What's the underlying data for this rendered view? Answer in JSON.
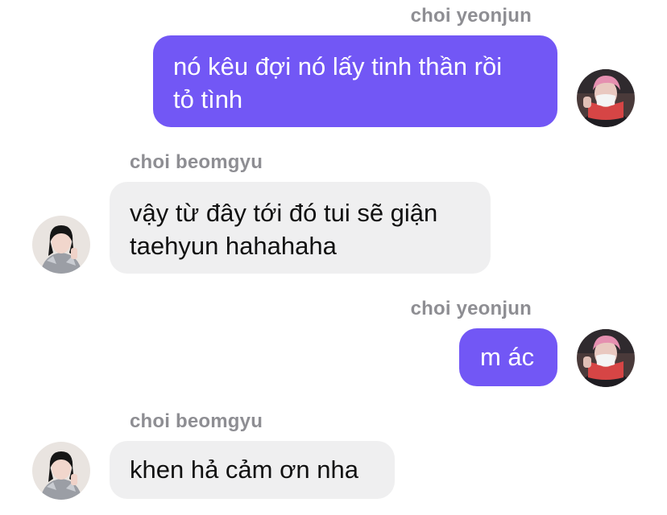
{
  "conversation": {
    "messages": [
      {
        "sender": "choi yeonjun",
        "direction": "outgoing",
        "text": "nó kêu đợi nó lấy tinh thần rồi\ntỏ tình",
        "avatar_icon": "avatar-pink-hair-icon"
      },
      {
        "sender": "choi beomgyu",
        "direction": "incoming",
        "text": "vậy từ đây tới đó tui sẽ giận\ntaehyun hahahaha",
        "avatar_icon": "avatar-dark-hair-icon"
      },
      {
        "sender": "choi yeonjun",
        "direction": "outgoing",
        "text": "m ác",
        "avatar_icon": "avatar-pink-hair-icon"
      },
      {
        "sender": "choi beomgyu",
        "direction": "incoming",
        "text": "khen hả cảm ơn nha",
        "avatar_icon": "avatar-dark-hair-icon"
      }
    ]
  },
  "colors": {
    "outgoing_bubble": "#7257f5",
    "incoming_bubble": "#efeff0",
    "sender_name": "#8e8e93",
    "background": "#ffffff"
  }
}
